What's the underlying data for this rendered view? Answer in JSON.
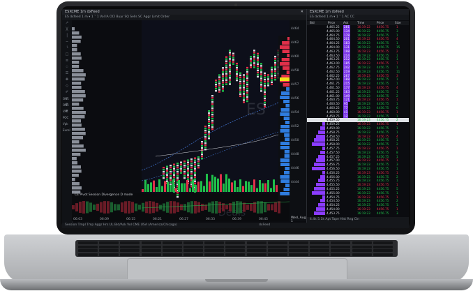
{
  "window_left": {
    "title": "ESXCME 1m dxFeed",
    "toolbar": "ES dxfeed   1 m ▾   1 ˅ 1   Vol  IA  OCI  Buyr  SQ  Sells  SC  Aggr  Limit Order",
    "watermark": "ES",
    "lower_label": "Deals",
    "lower_pane_title": "CE Pivot  Session  Divergence D mode",
    "dom_label": "DOM",
    "tools": [
      "↗",
      "╳",
      "│",
      "─",
      "╰",
      "□",
      "≡",
      "♤",
      "☰",
      "✥",
      "◇",
      "✐",
      "⌖",
      "⚙",
      "★"
    ],
    "side_labels": [
      "ON1",
      "ON1",
      "VAL",
      "POC",
      "Vpk",
      "Excel"
    ],
    "price_scale": [
      "4464",
      "4462",
      "4460",
      "4458",
      "4457",
      "4456",
      "4454",
      "4452",
      "4450",
      "4448",
      "4446",
      "4444"
    ],
    "time_labels": [
      "06:03",
      "06:09",
      "06:15",
      "06:21",
      "06:27",
      "06:33",
      "06:39",
      "06:45"
    ],
    "date_label": "Wed, Aug 1"
  },
  "window_right": {
    "title": "ESXCME 1m dxfeed",
    "toolbar": "ES dxfeed   1 m ▾   1 ˅ 1   AC  CC",
    "columns": [
      "Bid",
      "Price",
      "Ask",
      "Time",
      "Price",
      "Size"
    ],
    "rows": [
      {
        "price": "4,465.25",
        "ask": "281",
        "time": "16:19:22",
        "p2": "4456.75",
        "size": "1"
      },
      {
        "price": "4,465.00",
        "ask": "134",
        "time": "16:19:22",
        "p2": "4456.75",
        "size": "3"
      },
      {
        "price": "4,464.75",
        "ask": "178",
        "time": "16:19:22",
        "p2": "4456.75",
        "size": "1"
      },
      {
        "price": "4,464.50",
        "ask": "201",
        "time": "16:19:22",
        "p2": "4456.75",
        "size": "4"
      },
      {
        "price": "4,464.25",
        "ask": "183",
        "time": "16:19:23",
        "p2": "4456.75",
        "size": "1"
      },
      {
        "price": "4,464.00",
        "ask": "131",
        "time": "16:19:23",
        "p2": "4456.75",
        "size": "15"
      },
      {
        "price": "4,463.75",
        "ask": "198",
        "time": "16:19:23",
        "p2": "4456.75",
        "size": "2"
      },
      {
        "price": "4,463.50",
        "ask": "214",
        "time": "16:19:23",
        "p2": "4456.75",
        "size": "1"
      },
      {
        "price": "4,463.25",
        "ask": "212",
        "time": "16:19:23",
        "p2": "4456.75",
        "size": "1"
      },
      {
        "price": "4,463.00",
        "ask": "185",
        "time": "16:19:23",
        "p2": "4456.75",
        "size": "7"
      },
      {
        "price": "4,462.75",
        "ask": "242",
        "time": "16:19:23",
        "p2": "4456.75",
        "size": "1"
      },
      {
        "price": "4,462.50",
        "ask": "219",
        "time": "16:19:23",
        "p2": "4456.75",
        "size": "11"
      },
      {
        "price": "4,462.25",
        "ask": "267",
        "time": "16:19:23",
        "p2": "4456.75",
        "size": "3"
      },
      {
        "price": "4,462.00",
        "ask": "188",
        "time": "16:19:23",
        "p2": "4456.75",
        "size": "1"
      },
      {
        "price": "4,461.75",
        "ask": "215",
        "time": "16:19:23",
        "p2": "4456.75",
        "size": "1"
      },
      {
        "price": "4,461.50",
        "ask": "177",
        "time": "16:19:23",
        "p2": "4456.75",
        "size": "4"
      },
      {
        "price": "4,461.25",
        "ask": "163",
        "time": "16:19:23",
        "p2": "4456.75",
        "size": "1"
      },
      {
        "price": "4,461.00",
        "ask": "149",
        "time": "16:19:23",
        "p2": "4456.75",
        "size": "2"
      },
      {
        "price": "4,460.75",
        "ask": "121",
        "time": "16:19:23",
        "p2": "4456.75",
        "size": "1"
      },
      {
        "price": "4,460.50",
        "ask": "95",
        "time": "16:19:23",
        "p2": "4456.75",
        "size": "1"
      },
      {
        "price": "4,460.25",
        "ask": "77",
        "time": "16:19:23",
        "p2": "4456.75",
        "size": "6"
      },
      {
        "price": "4,460.00",
        "ask": "41",
        "time": "16:19:23",
        "p2": "4456.75",
        "size": "1"
      },
      {
        "price": "4,459.75",
        "ask": "12",
        "time": "16:19:23",
        "p2": "4456.75",
        "size": "1"
      },
      {
        "price": "4,459.50",
        "ask": "",
        "time": "16:19:23",
        "p2": "4456.75",
        "size": "2"
      },
      {
        "price": "4,459.25",
        "ask": "",
        "time": "16:19:23",
        "p2": "4456.75",
        "size": "1"
      },
      {
        "price": "4,459.00",
        "ask": "",
        "time": "16:19:23",
        "p2": "4456.75",
        "size": "1"
      },
      {
        "price": "4,458.75",
        "ask": "",
        "time": "16:19:23",
        "p2": "4456.75",
        "size": "1"
      },
      {
        "price": "4,458.50",
        "ask": "",
        "time": "16:19:23",
        "p2": "4456.75",
        "size": "4"
      },
      {
        "price": "4,458.25",
        "ask": "",
        "time": "16:19:23",
        "p2": "4456.75",
        "size": "1"
      },
      {
        "price": "4,458.00",
        "ask": "",
        "time": "16:19:23",
        "p2": "4456.75",
        "size": "2"
      },
      {
        "price": "4,457.75",
        "ask": "",
        "time": "16:19:23",
        "p2": "4456.75",
        "size": "1"
      },
      {
        "price": "4,457.50",
        "ask": "",
        "time": "16:19:23",
        "p2": "4456.75",
        "size": "8"
      },
      {
        "price": "4,457.25",
        "ask": "",
        "time": "16:19:23",
        "p2": "4456.75",
        "size": "1"
      },
      {
        "price": "4,457.00",
        "ask": "",
        "time": "16:19:23",
        "p2": "4456.75",
        "size": "1"
      },
      {
        "price": "4,456.75",
        "ask": "",
        "time": "16:19:23",
        "p2": "4456.75",
        "size": "3"
      },
      {
        "price": "4,456.50",
        "ask": "",
        "time": "16:19:23",
        "p2": "4456.75",
        "size": "1"
      },
      {
        "price": "4,456.25",
        "ask": "",
        "time": "16:19:23",
        "p2": "4456.75",
        "size": "1"
      },
      {
        "price": "4,456.00",
        "ask": "",
        "time": "16:19:23",
        "p2": "4456.75",
        "size": "2"
      },
      {
        "price": "4,455.75",
        "ask": "",
        "time": "16:19:23",
        "p2": "4456.75",
        "size": "1"
      },
      {
        "price": "4,455.50",
        "ask": "",
        "time": "16:19:23",
        "p2": "4456.75",
        "size": "1"
      },
      {
        "price": "4,455.25",
        "ask": "",
        "time": "16:19:23",
        "p2": "4456.75",
        "size": "5"
      },
      {
        "price": "4,455.00",
        "ask": "",
        "time": "16:19:23",
        "p2": "4456.75",
        "size": "1"
      },
      {
        "price": "4,454.75",
        "ask": "",
        "time": "16:19:23",
        "p2": "4456.75",
        "size": "1"
      },
      {
        "price": "4,454.50",
        "ask": "",
        "time": "16:19:23",
        "p2": "4456.75",
        "size": "2"
      },
      {
        "price": "4,454.25",
        "ask": "",
        "time": "16:19:23",
        "p2": "4456.75",
        "size": "1"
      },
      {
        "price": "4,454.00",
        "ask": "",
        "time": "16:19:23",
        "p2": "4456.75",
        "size": "1"
      },
      {
        "price": "4,453.75",
        "ask": "",
        "time": "16:19:23",
        "p2": "4456.75",
        "size": "3"
      }
    ],
    "bottom_bar": "4.4k    5.1k    Apt  Tape  Hist  Rng  Cln",
    "highlight_price": "4,459.50"
  },
  "status_left": "Session  Tmpl  Tmp  Aggr  Hrs  UL  Bid/Ask  Vol  CME USA (America/Chicago)",
  "status_right": "dxFeed",
  "accent_colors": {
    "green": "#1fbf4a",
    "red": "#e0304a",
    "purple": "#8b3cff",
    "blue": "#2f7de0",
    "yellow": "#f2e21b"
  }
}
